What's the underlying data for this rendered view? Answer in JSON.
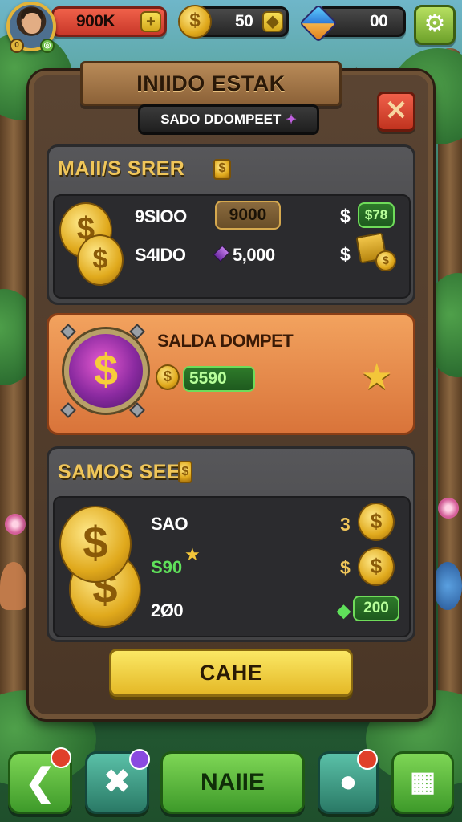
{
  "hud": {
    "currency_red": "900K",
    "currency_coins": "50",
    "currency_gems": "00",
    "plus_symbol": "+"
  },
  "panel": {
    "title": "INIIDO ESTAK",
    "subtitle": "SADO DDOMPEET",
    "close_symbol": "✕"
  },
  "section1": {
    "title": "MAII/S SRER",
    "row1_label": "9SIOO",
    "row1_field": "9000",
    "row1_dollar": "$",
    "row1_badge": "$78",
    "row2_label": "S4IDO",
    "row2_value": "5,000",
    "row2_dollar": "$"
  },
  "section2": {
    "title": "SALDA DOMPET",
    "field": "5590"
  },
  "section3": {
    "title": "SAMOS SEE",
    "row1_label": "SAO",
    "row1_right": "3",
    "row2_label": "S90",
    "row2_right": "$",
    "row3_label": "2Ø0",
    "row3_field": "200"
  },
  "confirm_label": "CAHE",
  "bottom_nav": {
    "center_label": "NAIIE"
  },
  "colors": {
    "accent_gold": "#f0c65a",
    "panel_brown": "#5a4432",
    "highlight_orange": "#e88a48",
    "green_button": "#5fbf3e"
  },
  "icons": [
    "gear-icon",
    "coin-icon",
    "gem-icon",
    "close-icon",
    "star-icon",
    "back-arrow-icon",
    "tools-icon",
    "map-pin-icon",
    "grid-icon"
  ]
}
